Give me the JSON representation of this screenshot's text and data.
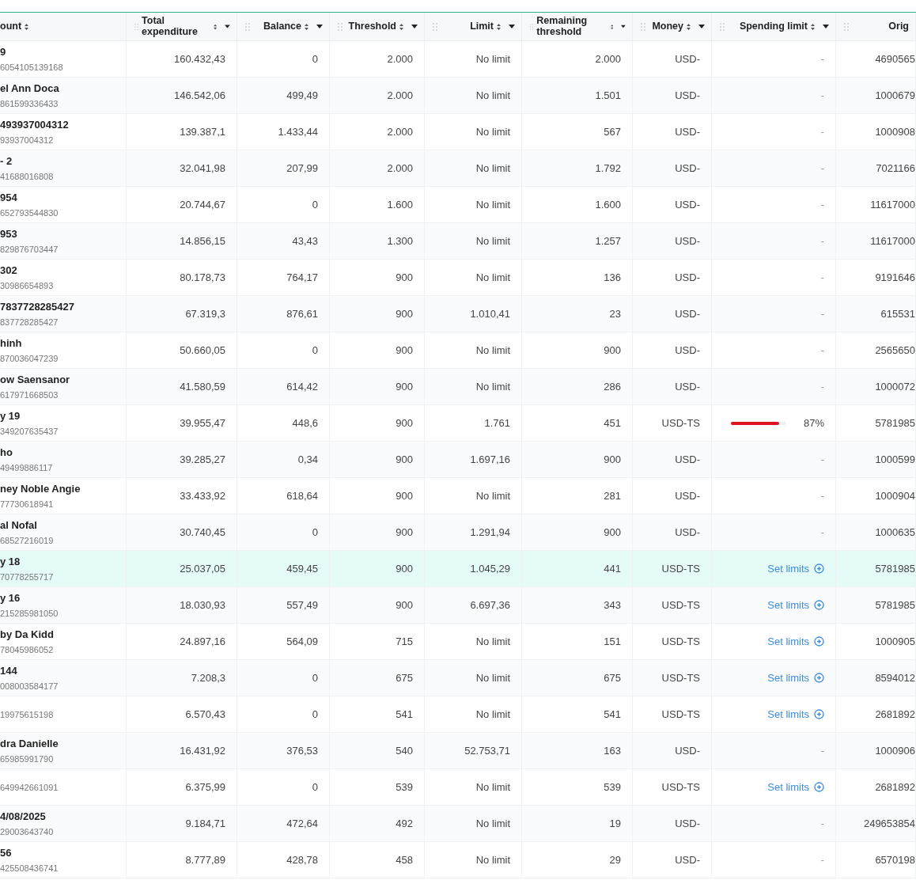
{
  "table": {
    "columns": [
      {
        "label": "ount",
        "handle": false
      },
      {
        "label": "Total expenditure",
        "handle": true
      },
      {
        "label": "Balance",
        "handle": true
      },
      {
        "label": "Threshold",
        "handle": true
      },
      {
        "label": "Limit",
        "handle": true
      },
      {
        "label": "Remaining threshold",
        "handle": true
      },
      {
        "label": "Money",
        "handle": true
      },
      {
        "label": "Spending limit",
        "handle": true
      },
      {
        "label": "Orig",
        "handle": true
      }
    ],
    "rows": [
      {
        "name": "9",
        "id": "6054105139168",
        "total": "160.432,43",
        "balance": "0",
        "threshold": "2.000",
        "limit": "No limit",
        "remaining": "2.000",
        "money": "USD-",
        "spending": {
          "kind": "none",
          "text": "-"
        },
        "orig": "4690565",
        "selected": false
      },
      {
        "name": "el Ann Doca",
        "id": "861599336433",
        "total": "146.542,06",
        "balance": "499,49",
        "threshold": "2.000",
        "limit": "No limit",
        "remaining": "1.501",
        "money": "USD-",
        "spending": {
          "kind": "none",
          "text": "-"
        },
        "orig": "1000679",
        "selected": false
      },
      {
        "name": "493937004312",
        "id": "93937004312",
        "total": "139.387,1",
        "balance": "1.433,44",
        "threshold": "2.000",
        "limit": "No limit",
        "remaining": "567",
        "money": "USD-",
        "spending": {
          "kind": "none",
          "text": "-"
        },
        "orig": "1000908",
        "selected": false
      },
      {
        "name": "- 2",
        "id": "41688016808",
        "total": "32.041,98",
        "balance": "207,99",
        "threshold": "2.000",
        "limit": "No limit",
        "remaining": "1.792",
        "money": "USD-",
        "spending": {
          "kind": "none",
          "text": "-"
        },
        "orig": "7021166",
        "selected": false
      },
      {
        "name": "954",
        "id": "652793544830",
        "total": "20.744,67",
        "balance": "0",
        "threshold": "1.600",
        "limit": "No limit",
        "remaining": "1.600",
        "money": "USD-",
        "spending": {
          "kind": "none",
          "text": "-"
        },
        "orig": "11617000",
        "selected": false
      },
      {
        "name": "953",
        "id": "829876703447",
        "total": "14.856,15",
        "balance": "43,43",
        "threshold": "1.300",
        "limit": "No limit",
        "remaining": "1.257",
        "money": "USD-",
        "spending": {
          "kind": "none",
          "text": "-"
        },
        "orig": "11617000",
        "selected": false
      },
      {
        "name": "302",
        "id": "30986654893",
        "total": "80.178,73",
        "balance": "764,17",
        "threshold": "900",
        "limit": "No limit",
        "remaining": "136",
        "money": "USD-",
        "spending": {
          "kind": "none",
          "text": "-"
        },
        "orig": "9191646",
        "selected": false
      },
      {
        "name": "7837728285427",
        "id": "837728285427",
        "total": "67.319,3",
        "balance": "876,61",
        "threshold": "900",
        "limit": "1.010,41",
        "remaining": "23",
        "money": "USD-",
        "spending": {
          "kind": "none",
          "text": "-"
        },
        "orig": "615531",
        "selected": false
      },
      {
        "name": "hinh",
        "id": "870036047239",
        "total": "50.660,05",
        "balance": "0",
        "threshold": "900",
        "limit": "No limit",
        "remaining": "900",
        "money": "USD-",
        "spending": {
          "kind": "none",
          "text": "-"
        },
        "orig": "2565650",
        "selected": false
      },
      {
        "name": "ow Saensanor",
        "id": "617971668503",
        "total": "41.580,59",
        "balance": "614,42",
        "threshold": "900",
        "limit": "No limit",
        "remaining": "286",
        "money": "USD-",
        "spending": {
          "kind": "none",
          "text": "-"
        },
        "orig": "1000072",
        "selected": false
      },
      {
        "name": "y 19",
        "id": "349207635437",
        "total": "39.955,47",
        "balance": "448,6",
        "threshold": "900",
        "limit": "1.761",
        "remaining": "451",
        "money": "USD-TS",
        "spending": {
          "kind": "bar",
          "level": 0.87,
          "text": "87%"
        },
        "orig": "5781985",
        "selected": false
      },
      {
        "name": "ho",
        "id": "49499886117",
        "total": "39.285,27",
        "balance": "0,34",
        "threshold": "900",
        "limit": "1.697,16",
        "remaining": "900",
        "money": "USD-",
        "spending": {
          "kind": "none",
          "text": "-"
        },
        "orig": "1000599",
        "selected": false
      },
      {
        "name": "ney Noble Angie",
        "id": "77730618941",
        "total": "33.433,92",
        "balance": "618,64",
        "threshold": "900",
        "limit": "No limit",
        "remaining": "281",
        "money": "USD-",
        "spending": {
          "kind": "none",
          "text": "-"
        },
        "orig": "1000904",
        "selected": false
      },
      {
        "name": "al Nofal",
        "id": "68527216019",
        "total": "30.740,45",
        "balance": "0",
        "threshold": "900",
        "limit": "1.291,94",
        "remaining": "900",
        "money": "USD-",
        "spending": {
          "kind": "none",
          "text": "-"
        },
        "orig": "1000635",
        "selected": false
      },
      {
        "name": "y 18",
        "id": "70778255717",
        "total": "25.037,05",
        "balance": "459,45",
        "threshold": "900",
        "limit": "1.045,29",
        "remaining": "441",
        "money": "USD-TS",
        "spending": {
          "kind": "link",
          "text": "Set limits"
        },
        "orig": "5781985",
        "selected": true
      },
      {
        "name": "y 16",
        "id": "215285981050",
        "total": "18.030,93",
        "balance": "557,49",
        "threshold": "900",
        "limit": "6.697,36",
        "remaining": "343",
        "money": "USD-TS",
        "spending": {
          "kind": "link",
          "text": "Set limits"
        },
        "orig": "5781985",
        "selected": false
      },
      {
        "name": "by Da Kidd",
        "id": "78045986052",
        "total": "24.897,16",
        "balance": "564,09",
        "threshold": "715",
        "limit": "No limit",
        "remaining": "151",
        "money": "USD-TS",
        "spending": {
          "kind": "link",
          "text": "Set limits"
        },
        "orig": "1000905",
        "selected": false
      },
      {
        "name": "144",
        "id": "008003584177",
        "total": "7.208,3",
        "balance": "0",
        "threshold": "675",
        "limit": "No limit",
        "remaining": "675",
        "money": "USD-TS",
        "spending": {
          "kind": "link",
          "text": "Set limits"
        },
        "orig": "8594012",
        "selected": false
      },
      {
        "id": "19975615198",
        "total": "6.570,43",
        "balance": "0",
        "threshold": "541",
        "limit": "No limit",
        "remaining": "541",
        "money": "USD-TS",
        "spending": {
          "kind": "link",
          "text": "Set limits"
        },
        "orig": "2681892",
        "selected": false
      },
      {
        "name": "dra Danielle",
        "id": "65985991790",
        "total": "16.431,92",
        "balance": "376,53",
        "threshold": "540",
        "limit": "52.753,71",
        "remaining": "163",
        "money": "USD-",
        "spending": {
          "kind": "none",
          "text": "-"
        },
        "orig": "1000906",
        "selected": false
      },
      {
        "id": "649942661091",
        "total": "6.375,99",
        "balance": "0",
        "threshold": "539",
        "limit": "No limit",
        "remaining": "539",
        "money": "USD-TS",
        "spending": {
          "kind": "link",
          "text": "Set limits"
        },
        "orig": "2681892",
        "selected": false
      },
      {
        "name": "4/08/2025",
        "id": "29003643740",
        "total": "9.184,71",
        "balance": "472,64",
        "threshold": "492",
        "limit": "No limit",
        "remaining": "19",
        "money": "USD-",
        "spending": {
          "kind": "none",
          "text": "-"
        },
        "orig": "249653854",
        "selected": false
      },
      {
        "name": "56",
        "id": "425508436741",
        "total": "8.777,89",
        "balance": "428,78",
        "threshold": "458",
        "limit": "No limit",
        "remaining": "29",
        "money": "USD-",
        "spending": {
          "kind": "none",
          "text": "-"
        },
        "orig": "6570198",
        "selected": false
      }
    ]
  }
}
